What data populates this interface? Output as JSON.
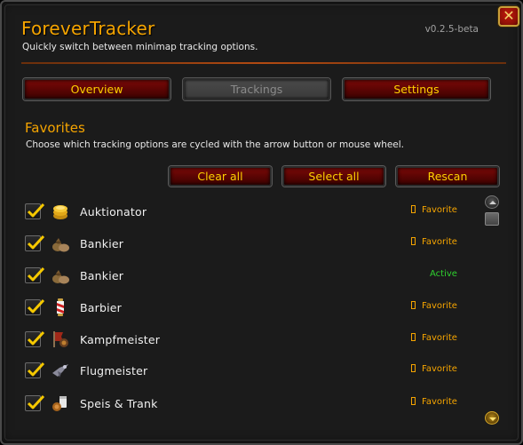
{
  "window": {
    "title": "ForeverTracker",
    "subtitle": "Quickly switch between minimap tracking options.",
    "version": "v0.2.5-beta",
    "close_label": "✕"
  },
  "tabs": [
    {
      "label": "Overview",
      "state": "enabled"
    },
    {
      "label": "Trackings",
      "state": "disabled"
    },
    {
      "label": "Settings",
      "state": "enabled"
    }
  ],
  "favorites": {
    "title": "Favorites",
    "description": "Choose which tracking options are cycled with the arrow button or mouse wheel.",
    "buttons": {
      "clear_all": "Clear all",
      "select_all": "Select all",
      "rescan": "Rescan"
    },
    "items": [
      {
        "name": "Auktionator",
        "icon": "coins-icon",
        "checked": true,
        "status": "Favorite"
      },
      {
        "name": "Bankier",
        "icon": "money-bag-icon",
        "checked": true,
        "status": "Favorite"
      },
      {
        "name": "Bankier",
        "icon": "money-bag-icon",
        "checked": true,
        "status": "Active"
      },
      {
        "name": "Barbier",
        "icon": "barber-pole-icon",
        "checked": true,
        "status": "Favorite"
      },
      {
        "name": "Kampfmeister",
        "icon": "battle-banner-icon",
        "checked": true,
        "status": "Favorite"
      },
      {
        "name": "Flugmeister",
        "icon": "flight-master-icon",
        "checked": true,
        "status": "Favorite"
      },
      {
        "name": "Speis & Trank",
        "icon": "food-drink-icon",
        "checked": true,
        "status": "Favorite"
      }
    ]
  },
  "colors": {
    "title_gold": "#f5a400",
    "button_text": "#ffd100",
    "active_green": "#2fd12f",
    "button_red": "#5f0504"
  }
}
